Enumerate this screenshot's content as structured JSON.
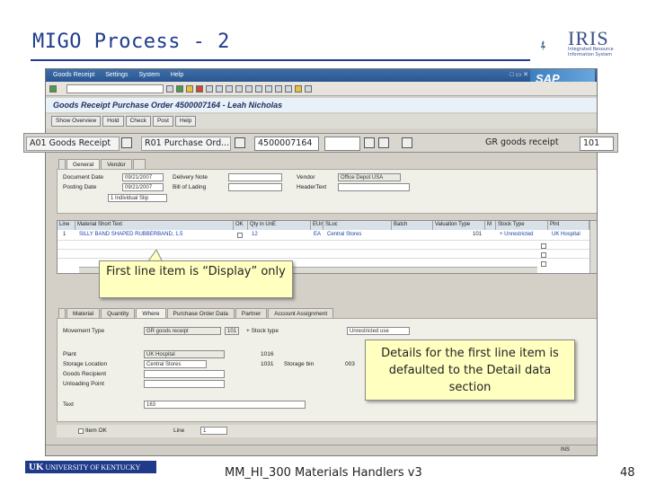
{
  "slide": {
    "title": "MIGO Process - 2",
    "logo_text": "IRIS",
    "logo_sub": "Integrated Resource Information System",
    "footer_logo": "UNIVERSITY OF KENTUCKY",
    "footer_logo_uk": "UK",
    "footer_text": "MM_HI_300 Materials Handlers v3",
    "page_number": "48"
  },
  "window": {
    "menu": [
      "Goods Receipt",
      "Settings",
      "System",
      "Help"
    ],
    "sap_logo": "SAP",
    "window_controls": "□ ▭ ✕",
    "title": "Goods Receipt Purchase Order 4500007164 - Leah Nicholas",
    "app_buttons": [
      "Show Overview",
      "Hold",
      "Check",
      "Post",
      "Help"
    ]
  },
  "header_row": {
    "action": "A01 Goods Receipt",
    "reference": "R01 Purchase Ord...",
    "po_number": "4500007164",
    "movement_label": "GR goods receipt",
    "movement_type": "101"
  },
  "header_tabs": [
    "General",
    "Vendor"
  ],
  "general": {
    "document_date_label": "Document Date",
    "document_date": "09/21/2007",
    "posting_date_label": "Posting Date",
    "posting_date": "09/21/2007",
    "delivery_note_label": "Delivery Note",
    "bill_of_lading_label": "Bill of Lading",
    "vendor_label": "Vendor",
    "vendor_value": "Office Depot USA",
    "header_text_label": "HeaderText",
    "slip_option": "1 Individual Slip"
  },
  "item_table": {
    "columns": [
      "Line",
      "Material Short Text",
      "OK",
      "Qty in UnE",
      "EUn",
      "SLoc",
      "Batch",
      "Valuation Type",
      "M",
      "Stock Type",
      "Plnt"
    ],
    "rows": [
      {
        "line": "1",
        "text": "SILLY BAND SHAPED RUBBERBAND, 1.5",
        "qty": "12",
        "eun": "EA",
        "sloc": "Central Stores",
        "batch": "",
        "mvt": "101",
        "stock": "+ Unrestricted",
        "plant": "UK Hospital"
      }
    ]
  },
  "detail_tabs": [
    "Material",
    "Quantity",
    "Where",
    "Purchase Order Data",
    "Partner",
    "Account Assignment"
  ],
  "detail": {
    "movement_type_label": "Movement Type",
    "movement_type_value": "GR goods receipt",
    "movement_code": "101",
    "stock_type_label": "+ Stock type",
    "stock_type_value": "Unrestricted use",
    "plant_label": "Plant",
    "plant_value": "UK Hospital",
    "plant_code": "1016",
    "storage_location_label": "Storage Location",
    "storage_location_value": "Central Stores",
    "storage_code": "1031",
    "storage_bin_label": "Storage bin",
    "storage_bin_value": "003",
    "goods_recipient_label": "Goods Recipient",
    "unloading_point_label": "Unloading Point",
    "text_label": "Text",
    "text_value": "163",
    "item_ok_label": "Item OK",
    "line_label": "Line",
    "line_value": "1"
  },
  "status_bar": {
    "left": "",
    "right": "INS"
  },
  "callouts": {
    "first_line": "First line item is “Display” only",
    "details": "Details for the first line item is defaulted to the Detail data section"
  },
  "colors": {
    "title_blue": "#1f3d8a",
    "callout_fill": "#ffffc0",
    "sap_bg": "#d4d0c8"
  }
}
